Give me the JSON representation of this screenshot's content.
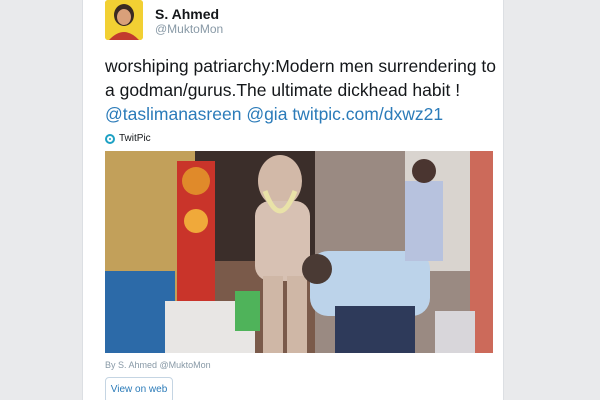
{
  "author": {
    "name": "S. Ahmed",
    "handle": "@MuktoMon"
  },
  "tweet": {
    "text_part1": "worshiping patriarchy:Modern men surrendering to a godman/gurus.The ultimate dickhead habit !",
    "mention1": "@taslimanasreen",
    "mention2": "@gia",
    "url": "twitpic.com/dxwz21"
  },
  "media": {
    "provider": "TwitPic",
    "provider_icon": "twitpic-icon",
    "credit": "By S. Ahmed @MuktoMon"
  },
  "actions": {
    "view_on_web": "View on web"
  },
  "colors": {
    "link": "#2b7bb9",
    "text": "#14171a",
    "muted": "#8899a6",
    "background": "#e9eaec"
  }
}
